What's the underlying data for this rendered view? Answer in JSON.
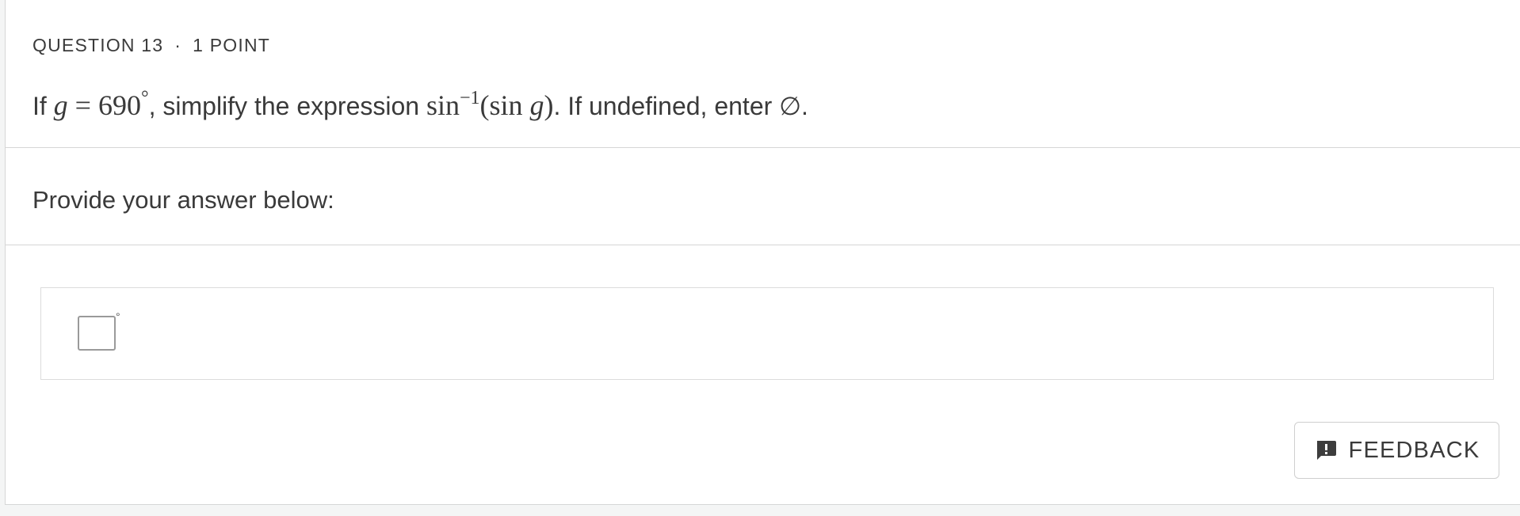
{
  "question": {
    "number_label": "QUESTION 13",
    "separator": "·",
    "points_label": "1 POINT",
    "text": {
      "prefix": "If ",
      "var_g": "g",
      "equals": " = ",
      "value": "690",
      "degree": "°",
      "middle": ", simplify the expression ",
      "func": "sin",
      "exponent": "−1",
      "open_paren": "(sin ",
      "inner_var": "g",
      "close_paren": ")",
      "suffix": ". If undefined, enter ∅."
    }
  },
  "answer": {
    "prompt": "Provide your answer below:",
    "input_value": "",
    "unit": "°"
  },
  "feedback": {
    "label": "FEEDBACK",
    "icon": "feedback-exclamation-icon"
  }
}
